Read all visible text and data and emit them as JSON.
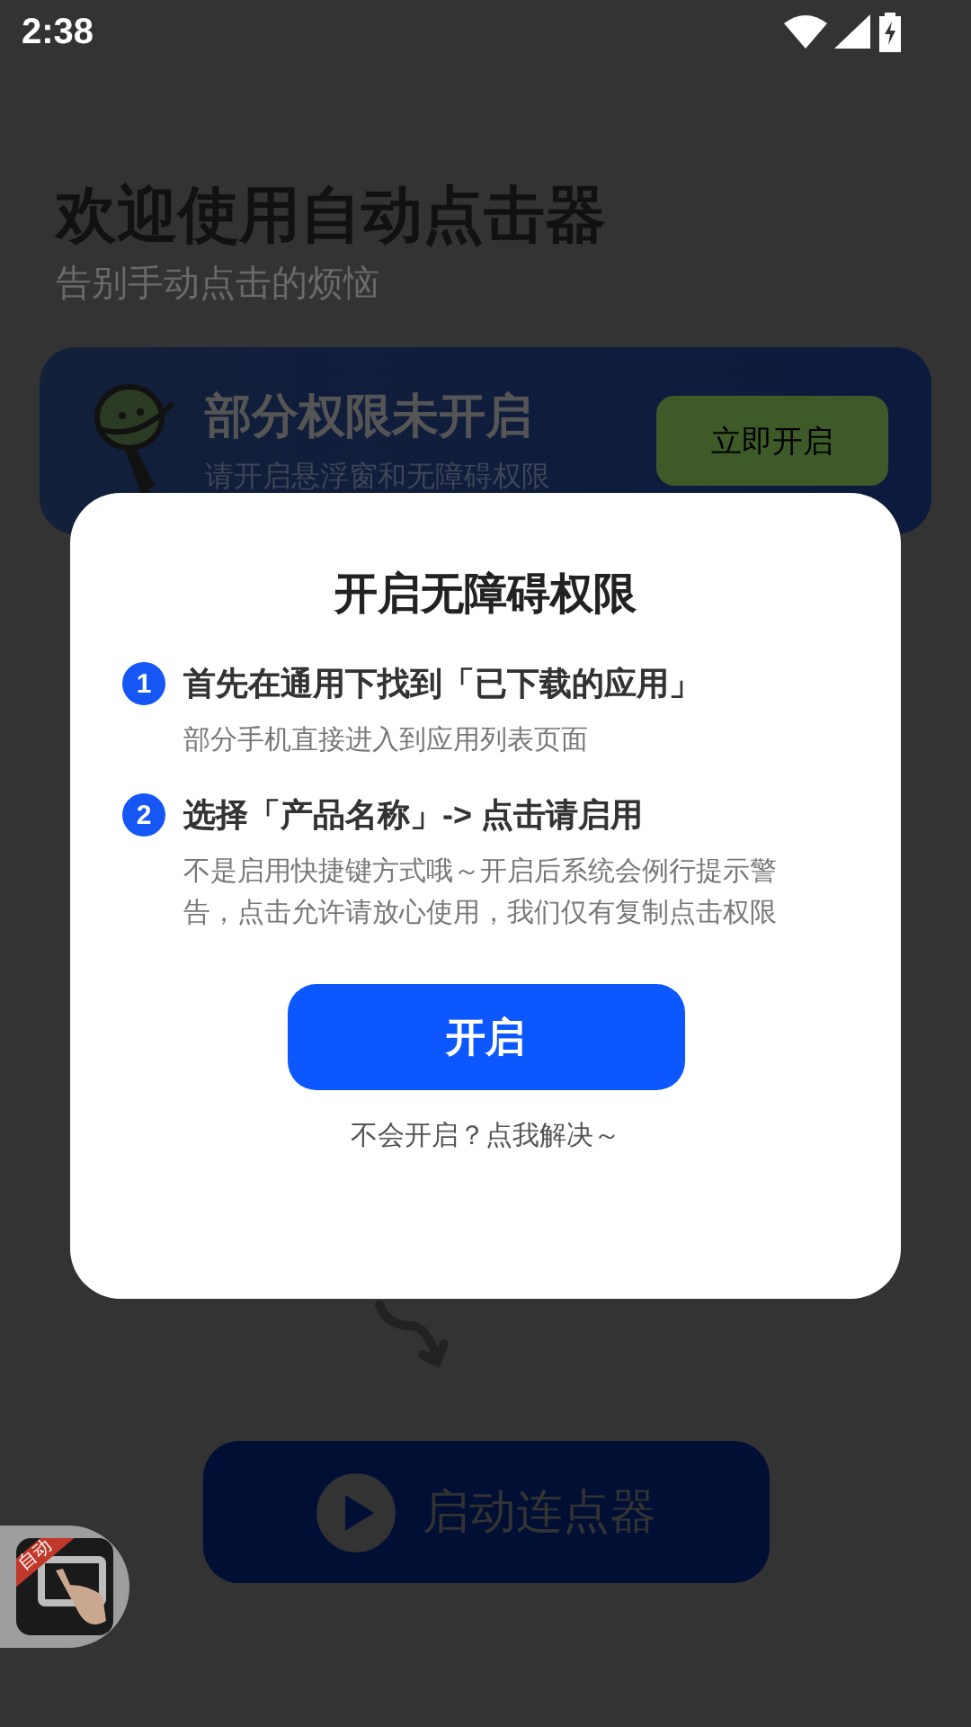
{
  "status_bar": {
    "time": "2:38"
  },
  "header": {
    "title": "欢迎使用自动点击器",
    "subtitle": "告别手动点击的烦恼"
  },
  "permission_banner": {
    "title": "部分权限未开启",
    "subtitle": "请开启悬浮窗和无障碍权限",
    "button": "立即开启"
  },
  "start_button": {
    "label": "启动连点器"
  },
  "floating_widget": {
    "badge": "自动"
  },
  "dialog": {
    "title": "开启无障碍权限",
    "steps": [
      {
        "number": "1",
        "title": "首先在通用下找到「已下载的应用」",
        "description": "部分手机直接进入到应用列表页面"
      },
      {
        "number": "2",
        "title": "选择「产品名称」-> 点击请启用",
        "description": "不是启用快捷键方式哦～开启后系统会例行提示警告，点击允许请放心使用，我们仅有复制点击权限"
      }
    ],
    "button": "开启",
    "help_link": "不会开启？点我解决～"
  }
}
